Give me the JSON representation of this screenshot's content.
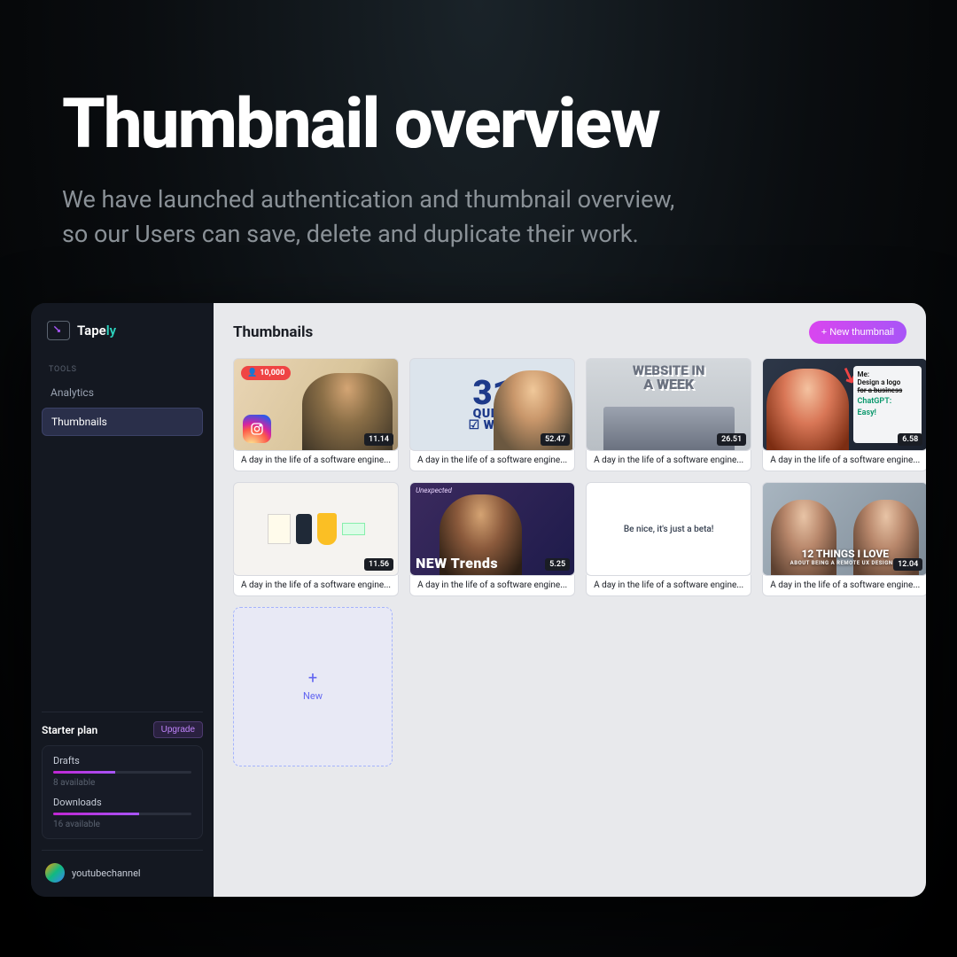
{
  "promo": {
    "title": "Thumbnail overview",
    "sub_line1": "We have launched authentication and thumbnail overview,",
    "sub_line2": "so our Users can save, delete and duplicate their work."
  },
  "brand": {
    "name_main": "Tape",
    "name_accent": "ly"
  },
  "sidebar": {
    "section": "TOOLS",
    "items": [
      {
        "label": "Analytics",
        "active": false
      },
      {
        "label": "Thumbnails",
        "active": true
      }
    ]
  },
  "plan": {
    "name": "Starter plan",
    "upgrade": "Upgrade",
    "meters": [
      {
        "label": "Drafts",
        "available_text": "8 available",
        "fill_pct": 45
      },
      {
        "label": "Downloads",
        "available_text": "16 available",
        "fill_pct": 62
      }
    ]
  },
  "user": {
    "name": "youtubechannel"
  },
  "main": {
    "title": "Thumbnails",
    "new_button": "+ New thumbnail",
    "new_tile": {
      "label": "New",
      "plus": "+"
    }
  },
  "thumbs": [
    {
      "badge": "10,000",
      "duration": "11.14",
      "caption": "A day in the life of a software engine..."
    },
    {
      "big_num": "31",
      "big_l1": "QUICK",
      "big_l2": "WINS",
      "duration": "52.47",
      "caption": "A day in the life of a software engine..."
    },
    {
      "l1": "WEBSITE IN",
      "l2": "A WEEK",
      "duration": "26.51",
      "caption": "A day in the life of a software engine..."
    },
    {
      "panel_l1": "Design a logo",
      "panel_l2": "for a business",
      "panel_l3": "Easy!",
      "duration": "6.58",
      "caption": "A day in the life of a software engine..."
    },
    {
      "duration": "11.56",
      "caption": "A day in the life of a software engine..."
    },
    {
      "tag": "Unexpected",
      "trend": "NEW Trends",
      "duration": "5.25",
      "caption": "A day in the life of a software engine..."
    },
    {
      "text": "Be nice, it's just a beta!",
      "caption": "A day in the life of a software engine..."
    },
    {
      "ov1": "12 THINGS I LOVE",
      "ov2": "ABOUT BEING A REMOTE UX DESIGNER",
      "duration": "12.04",
      "caption": "A day in the life of a software engine..."
    }
  ]
}
